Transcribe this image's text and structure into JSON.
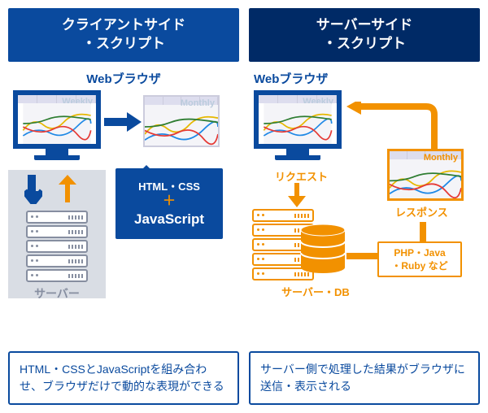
{
  "left": {
    "header_line1": "クライアントサイド",
    "header_line2": "・スクリプト",
    "browser_label": "Webブラウザ",
    "monitor_tag_1": "Weekly",
    "monitor_tag_2": "Monthly",
    "callout_line1": "HTML・CSS",
    "callout_plus": "＋",
    "callout_js": "JavaScript",
    "server_label": "サーバー",
    "note": "HTML・CSSとJavaScriptを組み合わせ、ブラウザだけで動的な表現ができる"
  },
  "right": {
    "header_line1": "サーバーサイド",
    "header_line2": "・スクリプト",
    "browser_label": "Webブラウザ",
    "monitor_tag_1": "Weekly",
    "monitor_tag_2": "Monthly",
    "request_label": "リクエスト",
    "response_label": "レスポンス",
    "server_db_label": "サーバー・DB",
    "lang_line1": "PHP・Java",
    "lang_line2": "・Ruby など",
    "note": "サーバー側で処理した結果がブラウザに送信・表示される"
  }
}
